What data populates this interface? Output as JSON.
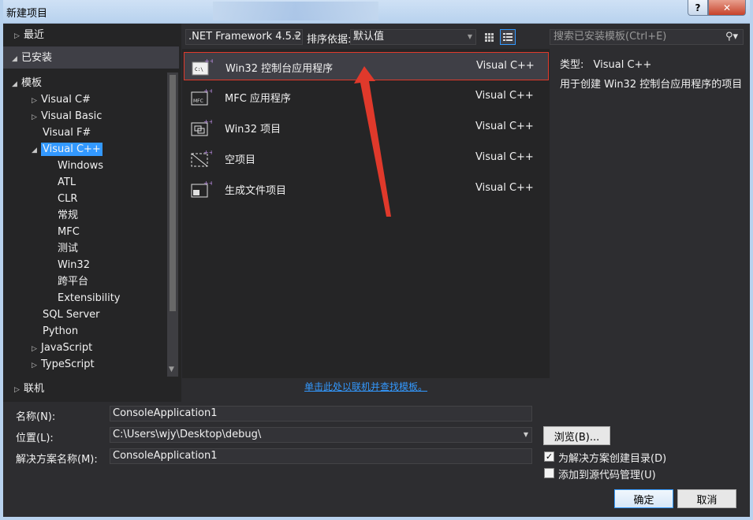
{
  "window": {
    "title": "新建项目",
    "help": "?",
    "close": "✕"
  },
  "tree": {
    "recent": "最近",
    "installed": "已安装",
    "templates": "模板",
    "items": [
      "Visual C#",
      "Visual Basic",
      "Visual F#",
      "Visual C++"
    ],
    "cpp_children": [
      "Windows",
      "ATL",
      "CLR",
      "常规",
      "MFC",
      "测试",
      "Win32",
      "跨平台",
      "Extensibility"
    ],
    "others": [
      "SQL Server",
      "Python",
      "JavaScript",
      "TypeScript"
    ],
    "online": "联机"
  },
  "toolbar": {
    "framework": ".NET Framework 4.5.2",
    "sort_label": "排序依据:",
    "sort_value": "默认值",
    "search_placeholder": "搜索已安装模板(Ctrl+E)"
  },
  "templates": [
    {
      "name": "Win32 控制台应用程序",
      "lang": "Visual C++",
      "icon": "console-app-icon"
    },
    {
      "name": "MFC 应用程序",
      "lang": "Visual C++",
      "icon": "mfc-app-icon"
    },
    {
      "name": "Win32 项目",
      "lang": "Visual C++",
      "icon": "win32-project-icon"
    },
    {
      "name": "空项目",
      "lang": "Visual C++",
      "icon": "empty-project-icon"
    },
    {
      "name": "生成文件项目",
      "lang": "Visual C++",
      "icon": "makefile-project-icon"
    }
  ],
  "info": {
    "type_label": "类型:",
    "type_value": "Visual C++",
    "description": "用于创建 Win32 控制台应用程序的项目"
  },
  "online_link": "单击此处以联机并查找模板。",
  "form": {
    "name_label": "名称(N):",
    "name_value": "ConsoleApplication1",
    "location_label": "位置(L):",
    "location_value": "C:\\Users\\wjy\\Desktop\\debug\\",
    "solution_label": "解决方案名称(M):",
    "solution_value": "ConsoleApplication1",
    "browse": "浏览(B)...",
    "create_dir_label": "为解决方案创建目录(D)",
    "create_dir_checked": true,
    "source_control_label": "添加到源代码管理(U)",
    "source_control_checked": false,
    "ok": "确定",
    "cancel": "取消"
  },
  "colors": {
    "accent": "#3399ff",
    "annotation": "#e0392b"
  }
}
